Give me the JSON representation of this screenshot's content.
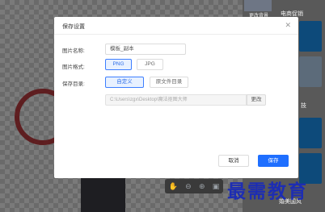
{
  "background": {
    "right_tab": "",
    "right_tab_label": "更改背景",
    "section_top": "电商促销",
    "section_mid": "技",
    "section_bottom": "婚美国风"
  },
  "dialog": {
    "title": "保存设置",
    "close_icon": "close-icon",
    "name_label": "图片名称:",
    "name_value": "模板_副本",
    "format_label": "图片格式:",
    "format_options": [
      "PNG",
      "JPG"
    ],
    "format_selected": "PNG",
    "dir_label": "保存目录:",
    "dir_options": [
      "自定义",
      "原文件目录"
    ],
    "dir_selected": "自定义",
    "path_value": "C:\\Users\\zgx\\Desktop\\魔法抠图大师",
    "change_label": "更改",
    "cancel_label": "取消",
    "save_label": "保存"
  },
  "watermark": "最需教育",
  "colors": {
    "primary": "#1f6fff",
    "watermark": "#1d2db3"
  }
}
